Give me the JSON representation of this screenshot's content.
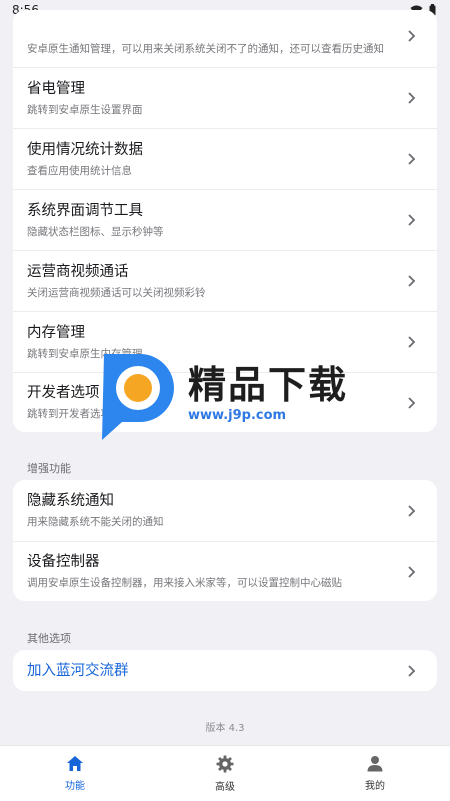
{
  "status_bar": {
    "time": "8:56"
  },
  "top_group": {
    "items": [
      {
        "title": "",
        "sub": "安卓原生通知管理，可以用来关闭系统关闭不了的通知，还可以查看历史通知"
      },
      {
        "title": "省电管理",
        "sub": "跳转到安卓原生设置界面"
      },
      {
        "title": "使用情况统计数据",
        "sub": "查看应用使用统计信息"
      },
      {
        "title": "系统界面调节工具",
        "sub": "隐藏状态栏图标、显示秒钟等"
      },
      {
        "title": "运营商视频通话",
        "sub": "关闭运营商视频通话可以关闭视频彩铃"
      },
      {
        "title": "内存管理",
        "sub": "跳转到安卓原生内存管理"
      },
      {
        "title": "开发者选项",
        "sub": "跳转到开发者选项"
      }
    ]
  },
  "enhance": {
    "label": "增强功能",
    "items": [
      {
        "title": "隐藏系统通知",
        "sub": "用来隐藏系统不能关闭的通知"
      },
      {
        "title": "设备控制器",
        "sub": "调用安卓原生设备控制器，用来接入米家等，可以设置控制中心磁贴"
      }
    ]
  },
  "other": {
    "label": "其他选项",
    "items": [
      {
        "title": "加入蓝河交流群"
      }
    ]
  },
  "version": "版本 4.3",
  "nav": {
    "items": [
      {
        "label": "功能",
        "icon": "home-icon",
        "active": true
      },
      {
        "label": "高级",
        "icon": "gear-icon",
        "active": false
      },
      {
        "label": "我的",
        "icon": "person-icon",
        "active": false
      }
    ]
  },
  "watermark": {
    "brand": "精品下载",
    "url": "www.j9p.com"
  },
  "colors": {
    "accent": "#1565d8",
    "background": "#f1f1f5",
    "card": "#ffffff"
  }
}
